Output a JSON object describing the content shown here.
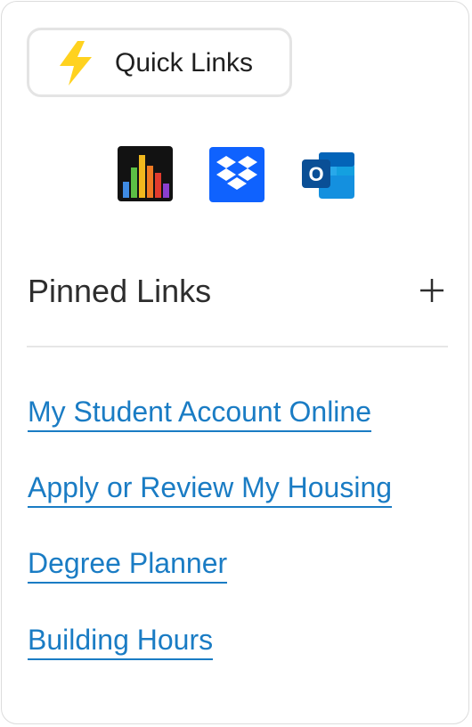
{
  "quick_links": {
    "label": "Quick Links",
    "icon": "lightning-bolt-icon"
  },
  "apps": [
    {
      "name": "analytics-chart-app-icon"
    },
    {
      "name": "dropbox-app-icon"
    },
    {
      "name": "outlook-app-icon",
      "letter": "O"
    }
  ],
  "pinned": {
    "title": "Pinned Links",
    "add_symbol": "+"
  },
  "links": [
    {
      "label": "My Student Account Online"
    },
    {
      "label": "Apply or Review My Housing"
    },
    {
      "label": "Degree Planner"
    },
    {
      "label": "Building Hours"
    }
  ],
  "colors": {
    "link": "#1a7cc4",
    "bolt": "#ffd21f",
    "dropbox": "#0f62fe",
    "outlook": "#0a64b8"
  }
}
